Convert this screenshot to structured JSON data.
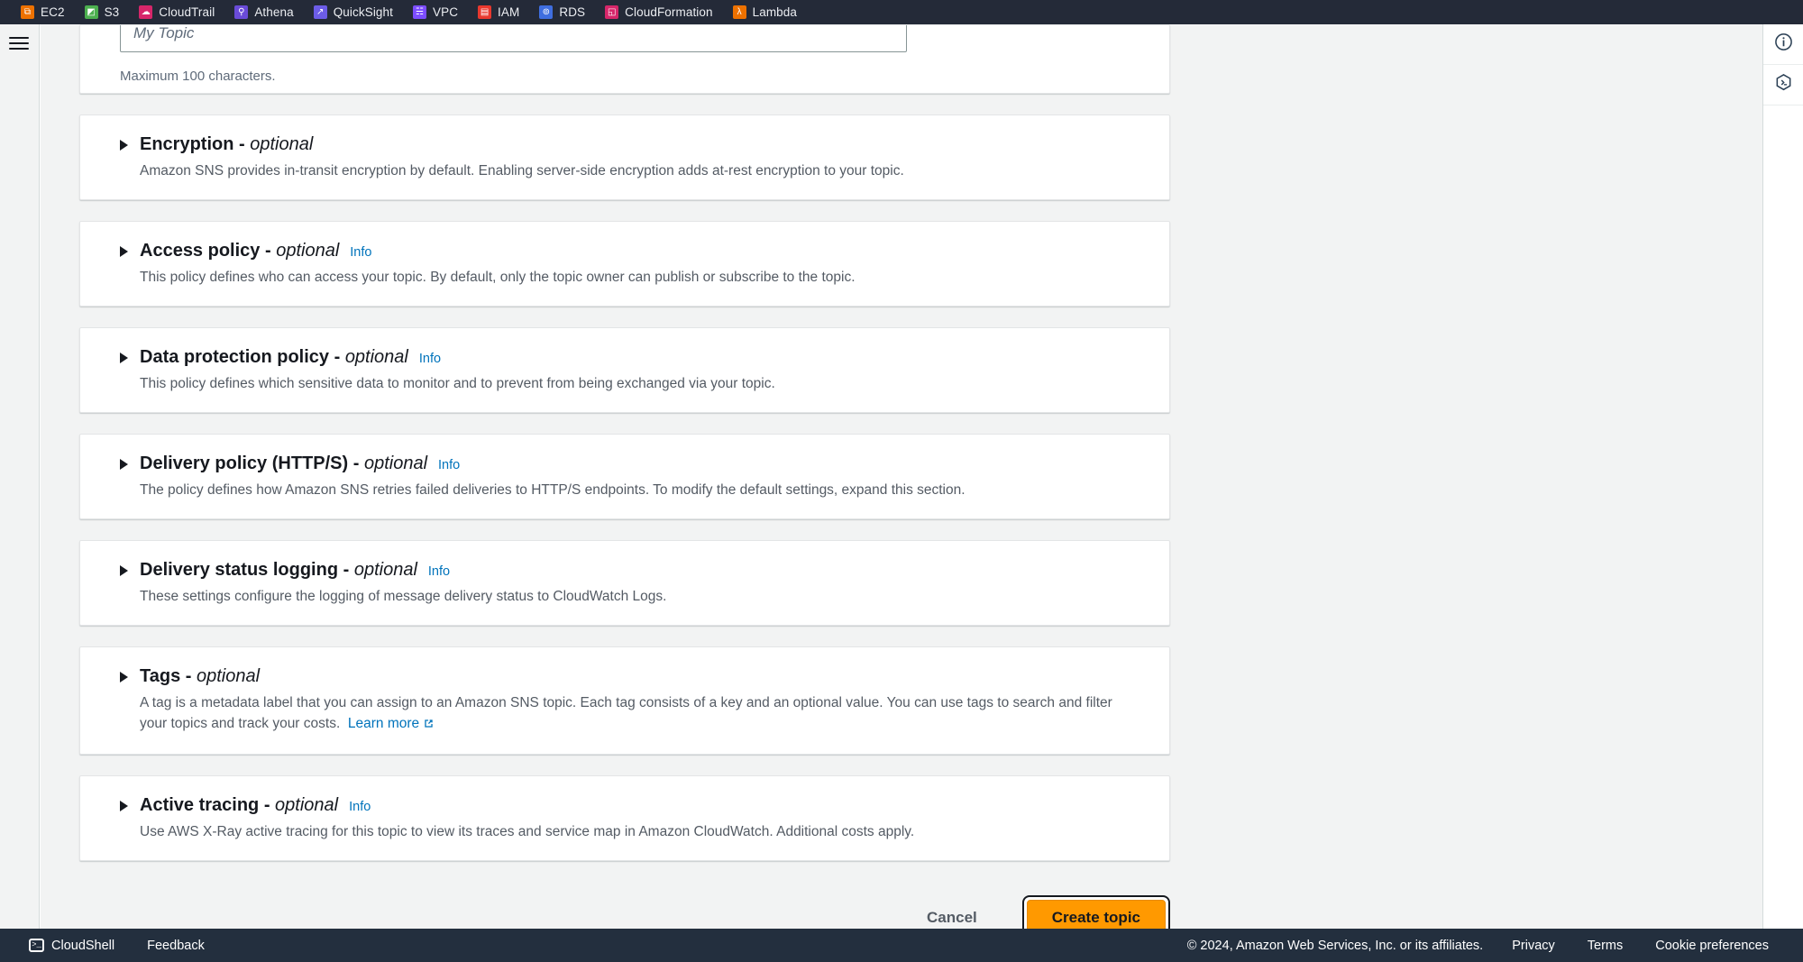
{
  "browser": {
    "bookmarks": [
      {
        "label": "EC2",
        "icon": "ec2-favicon",
        "color": "#ed7100",
        "glyph": "⧉"
      },
      {
        "label": "S3",
        "icon": "s3-favicon",
        "color": "#4caf4f",
        "glyph": "◩"
      },
      {
        "label": "CloudTrail",
        "icon": "cloudtrail-favicon",
        "color": "#d6266a",
        "glyph": "☁"
      },
      {
        "label": "Athena",
        "icon": "athena-favicon",
        "color": "#6a4bd8",
        "glyph": "⚲"
      },
      {
        "label": "QuickSight",
        "icon": "quicksight-favicon",
        "color": "#6c5ce7",
        "glyph": "↗"
      },
      {
        "label": "VPC",
        "icon": "vpc-favicon",
        "color": "#7c4dff",
        "glyph": "☵"
      },
      {
        "label": "IAM",
        "icon": "iam-favicon",
        "color": "#e8382e",
        "glyph": "▤"
      },
      {
        "label": "RDS",
        "icon": "rds-favicon",
        "color": "#3f6ee0",
        "glyph": "⊚"
      },
      {
        "label": "CloudFormation",
        "icon": "cloudformation-favicon",
        "color": "#d6266a",
        "glyph": "◱"
      },
      {
        "label": "Lambda",
        "icon": "lambda-favicon",
        "color": "#ed7100",
        "glyph": "λ"
      }
    ]
  },
  "nav": {
    "menu_icon": "hamburger-menu-icon"
  },
  "form": {
    "name_field": {
      "placeholder": "My Topic",
      "value": "",
      "hint": "Maximum 100 characters."
    },
    "sections": [
      {
        "title": "Encryption",
        "optional": "optional",
        "info": "",
        "description": "Amazon SNS provides in-transit encryption by default. Enabling server-side encryption adds at-rest encryption to your topic."
      },
      {
        "title": "Access policy",
        "optional": "optional",
        "info": "Info",
        "description": "This policy defines who can access your topic. By default, only the topic owner can publish or subscribe to the topic."
      },
      {
        "title": "Data protection policy",
        "optional": "optional",
        "info": "Info",
        "description": "This policy defines which sensitive data to monitor and to prevent from being exchanged via your topic."
      },
      {
        "title": "Delivery policy (HTTP/S)",
        "optional": "optional",
        "info": "Info",
        "description": "The policy defines how Amazon SNS retries failed deliveries to HTTP/S endpoints. To modify the default settings, expand this section."
      },
      {
        "title": "Delivery status logging",
        "optional": "optional",
        "info": "Info",
        "description": "These settings configure the logging of message delivery status to CloudWatch Logs."
      },
      {
        "title": "Tags",
        "optional": "optional",
        "info": "",
        "description": "A tag is a metadata label that you can assign to an Amazon SNS topic. Each tag consists of a key and an optional value. You can use tags to search and filter your topics and track your costs.",
        "link_label": "Learn more"
      },
      {
        "title": "Active tracing",
        "optional": "optional",
        "info": "Info",
        "description": "Use AWS X-Ray active tracing for this topic to view its traces and service map in Amazon CloudWatch. Additional costs apply."
      }
    ],
    "actions": {
      "cancel_label": "Cancel",
      "submit_label": "Create topic"
    }
  },
  "right_rail": {
    "buttons": [
      {
        "icon": "info-circle-icon"
      },
      {
        "icon": "cloudshell-hex-icon"
      }
    ]
  },
  "footer": {
    "cloudshell_label": "CloudShell",
    "feedback_label": "Feedback",
    "copyright": "© 2024, Amazon Web Services, Inc. or its affiliates.",
    "links": [
      "Privacy",
      "Terms",
      "Cookie preferences"
    ]
  },
  "theme": {
    "accent_orange": "#ff9900",
    "link_blue": "#0073bb",
    "nav_dark": "#232f3e",
    "bookmarks_dark": "#242a38",
    "page_bg": "#f2f3f3"
  }
}
